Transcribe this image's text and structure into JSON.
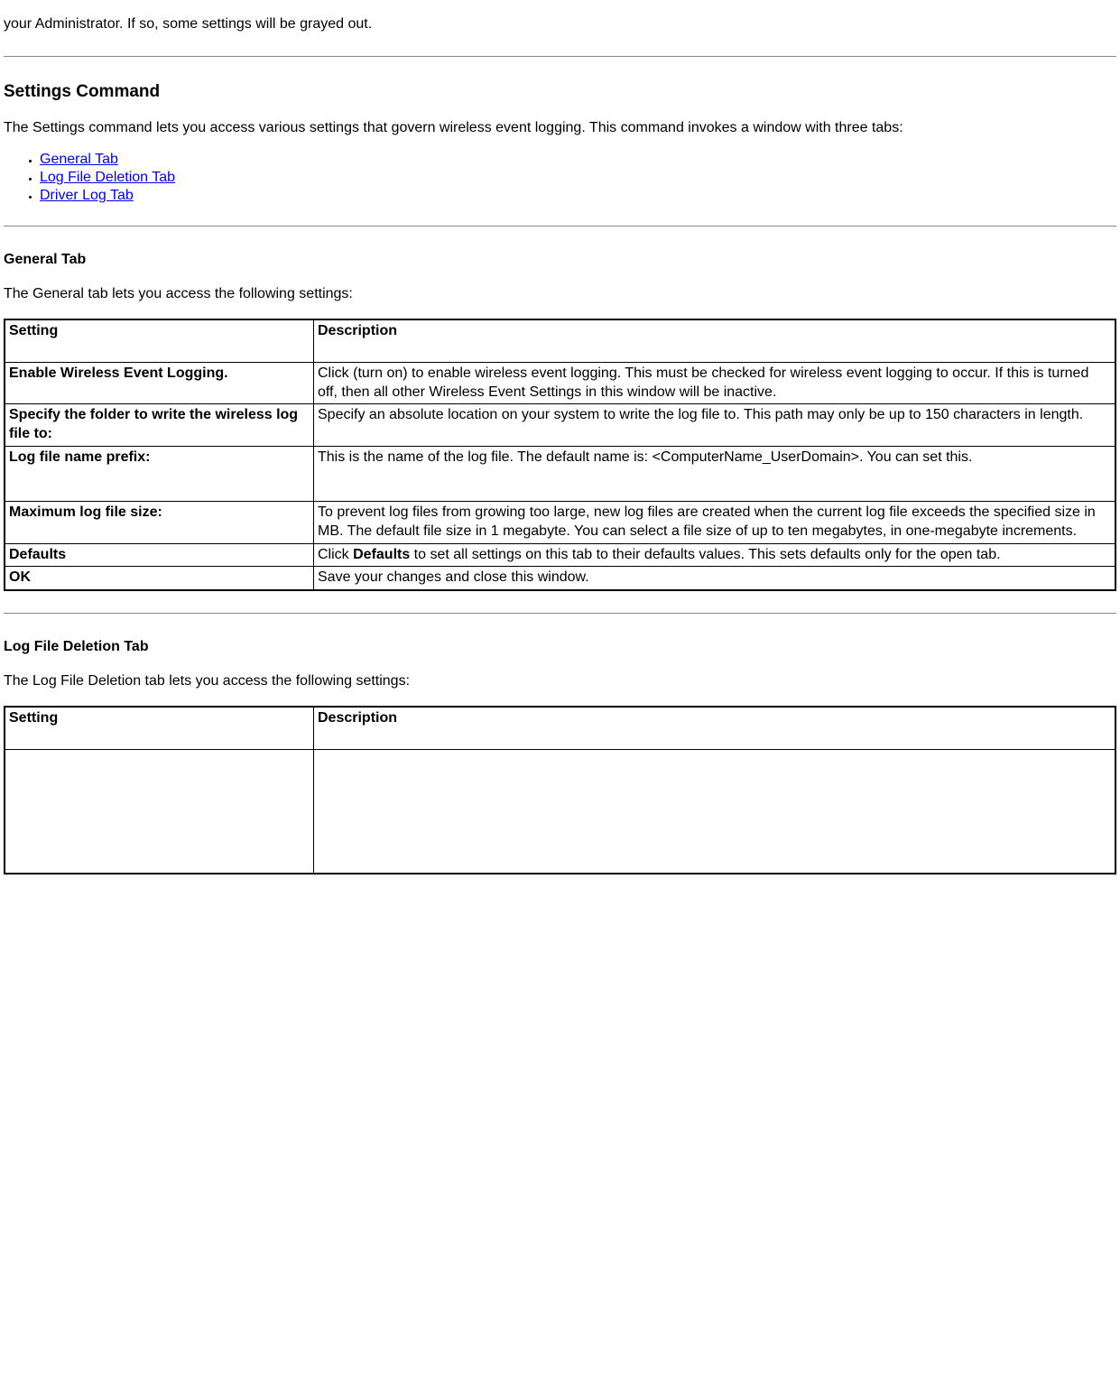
{
  "intro_fragment": "your Administrator. If so, some settings will be grayed out.",
  "settings_command": {
    "heading": "Settings Command",
    "para": "The Settings command lets you access various settings that govern wireless event logging. This command invokes a window with three tabs:",
    "links": {
      "general": "General Tab ",
      "logdel": "Log File Deletion Tab",
      "driver": "Driver Log Tab"
    }
  },
  "general_tab": {
    "heading": "General Tab",
    "para": "The General tab lets you access the following settings:",
    "table": {
      "h1": "Setting",
      "h2": "Description",
      "r1c1": "Enable Wireless Event Logging.",
      "r1c2": "Click (turn on) to enable wireless event logging. This must be checked for wireless event logging to occur. If this is turned off, then all other Wireless Event Settings in this window will be inactive.",
      "r2c1": "Specify the folder to write the wireless log file to:",
      "r2c2": "Specify an absolute location on your system to write the log file to. This path may only be up to 150 characters in length.",
      "r3c1": "Log file name prefix:",
      "r3c2": "This is the name of the log file. The default name is: <ComputerName_UserDomain>. You can set this.",
      "r4c1": "Maximum log file size:",
      "r4c2": "To prevent log files from growing too large, new log files are created when the current log file exceeds the specified size in MB. The default file size in 1 megabyte. You can select a file size of up to ten megabytes, in one-megabyte increments.",
      "r5c1": "Defaults",
      "r5c2_a": "Click ",
      "r5c2_b": "Defaults",
      "r5c2_c": " to set all settings on this tab to their defaults values. This sets defaults only for the open tab.",
      "r6c1": "OK",
      "r6c2": "Save your changes and close this window."
    }
  },
  "logdel_tab": {
    "heading": "Log File Deletion Tab",
    "para": "The Log File Deletion tab lets you access the following settings:",
    "table": {
      "h1": "Setting",
      "h2": "Description"
    }
  }
}
